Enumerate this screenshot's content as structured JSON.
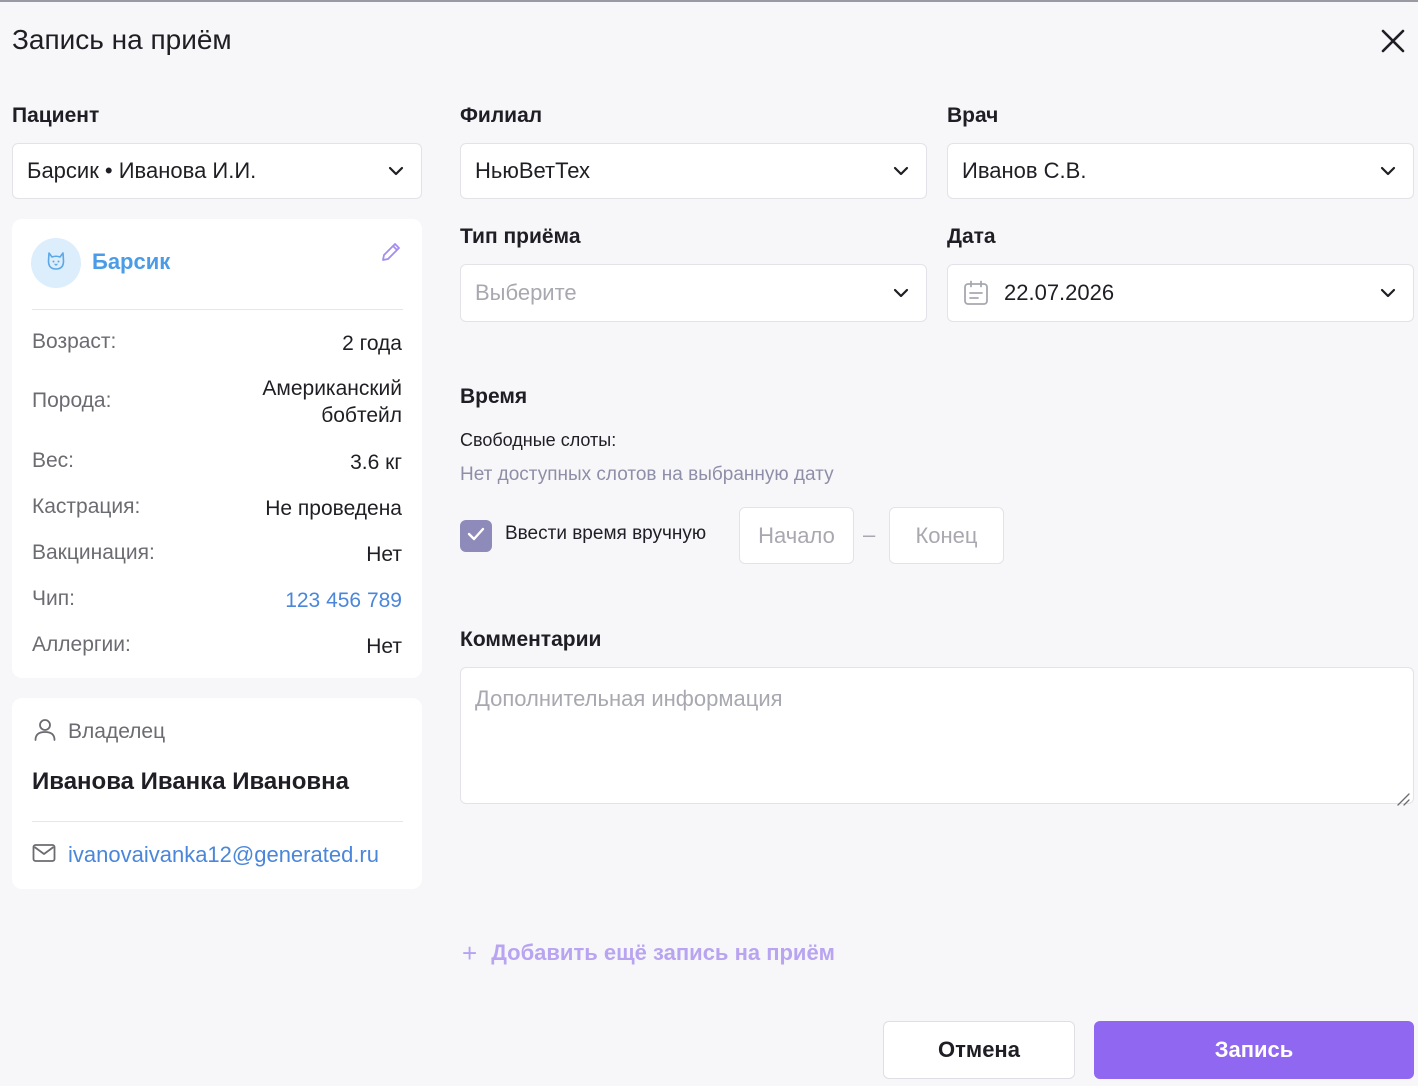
{
  "dialog": {
    "title": "Запись на приём"
  },
  "patient": {
    "label": "Пациент",
    "selected": "Барсик • Иванова И.И."
  },
  "pet_card": {
    "name": "Барсик",
    "rows": [
      {
        "key": "Возраст:",
        "value": "2 года"
      },
      {
        "key": "Порода:",
        "value": "Американский бобтейл"
      },
      {
        "key": "Вес:",
        "value": "3.6 кг"
      },
      {
        "key": "Кастрация:",
        "value": "Не проведена"
      },
      {
        "key": "Вакцинация:",
        "value": "Нет"
      },
      {
        "key": "Чип:",
        "value": "123 456 789"
      },
      {
        "key": "Аллергии:",
        "value": "Нет"
      }
    ]
  },
  "owner_card": {
    "heading": "Владелец",
    "name": "Иванова Иванка Ивановна",
    "email": "ivanovaivanka12@generated.ru"
  },
  "branch": {
    "label": "Филиал",
    "selected": "НьюВетТех"
  },
  "doctor": {
    "label": "Врач",
    "selected": "Иванов С.В."
  },
  "visit_type": {
    "label": "Тип приёма",
    "placeholder": "Выберите"
  },
  "date": {
    "label": "Дата",
    "selected": "22.07.2026"
  },
  "time": {
    "title": "Время",
    "slots_label": "Свободные слоты:",
    "slots_empty": "Нет доступных слотов на выбранную дату",
    "manual_label": "Ввести время вручную",
    "manual_checked": true,
    "start_placeholder": "Начало",
    "separator": "–",
    "end_placeholder": "Конец"
  },
  "comments": {
    "title": "Комментарии",
    "placeholder": "Дополнительная информация"
  },
  "actions": {
    "add_more": "Добавить ещё запись на приём",
    "cancel": "Отмена",
    "submit": "Запись"
  },
  "colors": {
    "accent": "#8f67f0",
    "link": "#4a86d9",
    "checkbox": "#8e8ab9"
  }
}
